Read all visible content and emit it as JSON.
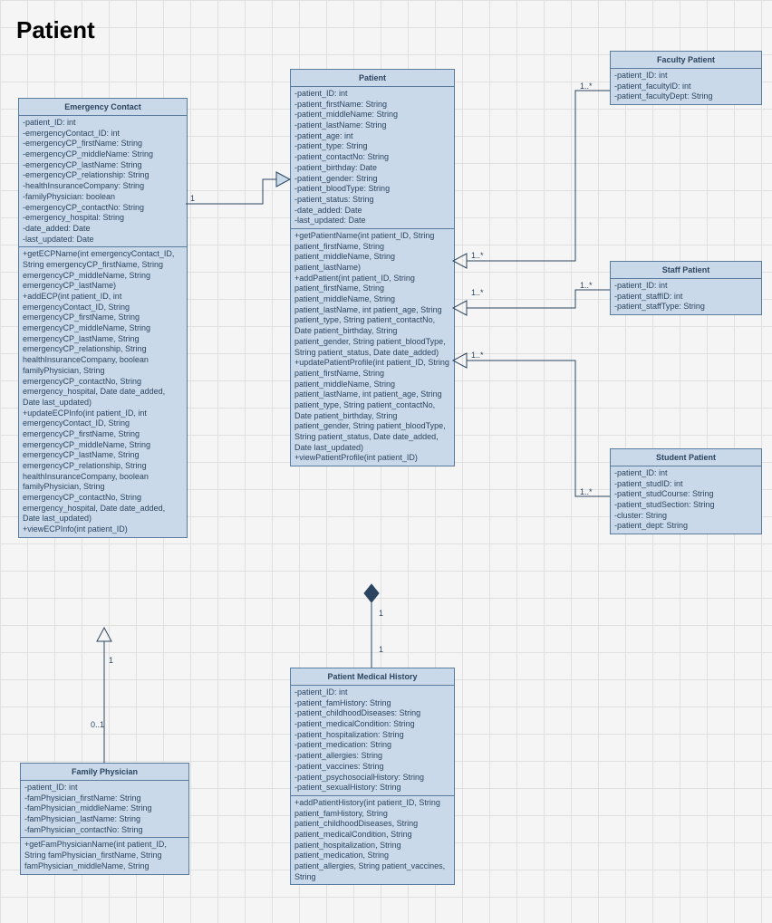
{
  "title": "Patient",
  "classes": {
    "emergencyContact": {
      "name": "Emergency Contact",
      "attributes": [
        "-patient_ID: int",
        "-emergencyContact_ID: int",
        "-emergencyCP_firstName: String",
        "-emergencyCP_middleName: String",
        "-emergencyCP_lastName: String",
        "-emergencyCP_relationship: String",
        "-healthInsuranceCompany: String",
        "-familyPhysician: boolean",
        "-emergencyCP_contactNo: String",
        "-emergency_hospital: String",
        "-date_added: Date",
        "-last_updated: Date"
      ],
      "methods": [
        "+getECPName(int emergencyContact_ID, String emergencyCP_firstName, String emergencyCP_middleName, String emergencyCP_lastName)",
        "+addECP(int patient_ID, int emergencyContact_ID, String emergencyCP_firstName, String emergencyCP_middleName, String emergencyCP_lastName, String emergencyCP_relationship, String healthInsuranceCompany, boolean familyPhysician, String emergencyCP_contactNo, String emergency_hospital, Date date_added, Date last_updated)",
        "+updateECPInfo(int patient_ID, int emergencyContact_ID, String emergencyCP_firstName, String emergencyCP_middleName, String emergencyCP_lastName, String emergencyCP_relationship, String healthInsuranceCompany, boolean familyPhysician, String emergencyCP_contactNo, String emergency_hospital, Date date_added, Date last_updated)",
        "+viewECPInfo(int patient_ID)"
      ]
    },
    "patient": {
      "name": "Patient",
      "attributes": [
        "-patient_ID: int",
        "-patient_firstName: String",
        "-patient_middleName: String",
        "-patient_lastName: String",
        "-patient_age: int",
        "-patient_type: String",
        "-patient_contactNo: String",
        "-patient_birthday: Date",
        "-patient_gender: String",
        "-patient_bloodType: String",
        "-patient_status: String",
        "-date_added: Date",
        "-last_updated: Date"
      ],
      "methods": [
        "+getPatientName(int patient_ID, String patient_firstName, String patient_middleName, String patient_lastName)",
        "+addPatient(int patient_ID, String patient_firstName, String patient_middleName, String patient_lastName, int patient_age, String patient_type, String patient_contactNo, Date patient_birthday, String patient_gender, String patient_bloodType, String patient_status, Date date_added)",
        "+updatePatientProfile(int patient_ID, String patient_firstName, String patient_middleName, String patient_lastName, int patient_age, String patient_type, String patient_contactNo, Date patient_birthday, String patient_gender, String patient_bloodType, String patient_status, Date date_added, Date last_updated)",
        "+viewPatientProfile(int patient_ID)"
      ]
    },
    "facultyPatient": {
      "name": "Faculty Patient",
      "attributes": [
        "-patient_ID: int",
        "-patient_facultyID: int",
        "-patient_facultyDept: String"
      ],
      "methods": []
    },
    "staffPatient": {
      "name": "Staff Patient",
      "attributes": [
        "-patient_ID: int",
        "-patient_staffID: int",
        "-patient_staffType: String"
      ],
      "methods": []
    },
    "studentPatient": {
      "name": "Student Patient",
      "attributes": [
        "-patient_ID: int",
        "-patient_studID: int",
        "-patient_studCourse: String",
        "-patient_studSection: String",
        "-cluster: String",
        "-patient_dept: String"
      ],
      "methods": []
    },
    "familyPhysician": {
      "name": "Family Physician",
      "attributes": [
        "-patient_ID: int",
        "-famPhysician_firstName: String",
        "-famPhysician_middleName: String",
        "-famPhysician_lastName: String",
        "-famPhysician_contactNo: String"
      ],
      "methods": [
        "+getFamPhysicianName(int patient_ID, String famPhysician_firstName, String famPhysician_middleName, String"
      ]
    },
    "patientMedicalHistory": {
      "name": "Patient Medical History",
      "attributes": [
        "-patient_ID: int",
        "-patient_famHistory: String",
        "-patient_childhoodDiseases: String",
        "-patient_medicalCondition: String",
        "-patient_hospitalization: String",
        "-patient_medication: String",
        "-patient_allergies: String",
        "-patient_vaccines: String",
        "-patient_psychosocialHistory: String",
        "-patient_sexualHistory: String"
      ],
      "methods": [
        "+addPatientHistory(int patient_ID, String patient_famHistory, String patient_childhoodDiseases, String patient_medicalCondition, String patient_hospitalization, String patient_medication, String patient_allergies, String patient_vaccines, String"
      ]
    }
  },
  "multiplicities": {
    "m1": "1",
    "m1s": "1..*",
    "m01": "0..1"
  }
}
